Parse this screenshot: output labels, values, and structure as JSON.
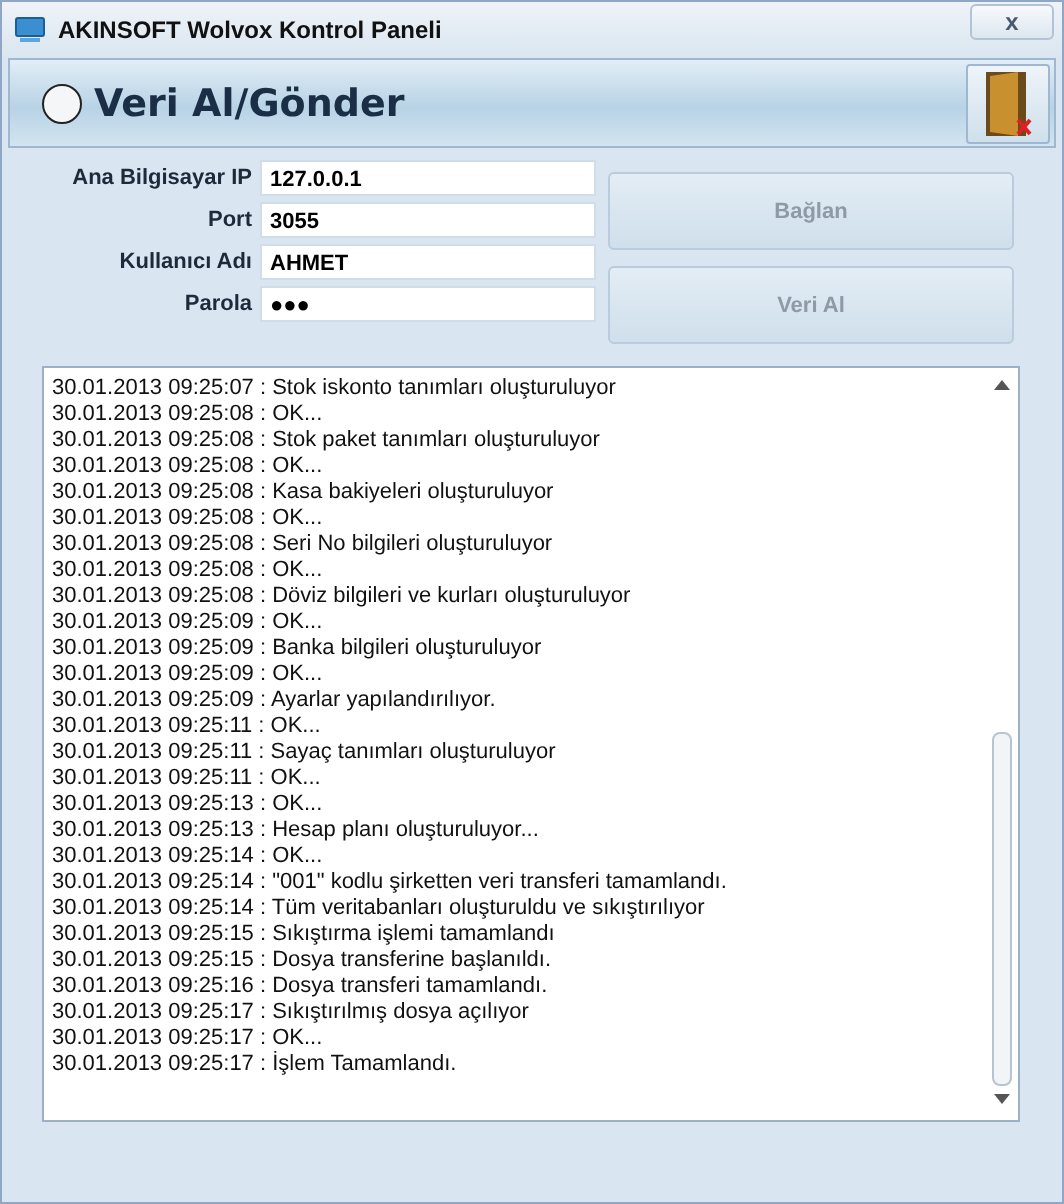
{
  "window": {
    "title": "AKINSOFT Wolvox Kontrol Paneli",
    "close_symbol": "x"
  },
  "header": {
    "title": "Veri Al/Gönder"
  },
  "form": {
    "fields": [
      {
        "label": "Ana Bilgisayar IP",
        "value": "127.0.0.1"
      },
      {
        "label": "Port",
        "value": "3055"
      },
      {
        "label": "Kullanıcı Adı",
        "value": "AHMET"
      },
      {
        "label": "Parola",
        "value": "●●●"
      }
    ],
    "buttons": [
      {
        "label": "Bağlan",
        "disabled": true
      },
      {
        "label": "Veri Al",
        "disabled": true
      }
    ]
  },
  "log": [
    "30.01.2013 09:25:07 : Stok iskonto tanımları oluşturuluyor",
    "30.01.2013 09:25:08 : OK...",
    "30.01.2013 09:25:08 : Stok paket tanımları oluşturuluyor",
    "30.01.2013 09:25:08 : OK...",
    "30.01.2013 09:25:08 : Kasa bakiyeleri oluşturuluyor",
    "30.01.2013 09:25:08 : OK...",
    "30.01.2013 09:25:08 : Seri No bilgileri oluşturuluyor",
    "30.01.2013 09:25:08 : OK...",
    "30.01.2013 09:25:08 : Döviz bilgileri ve kurları oluşturuluyor",
    "30.01.2013 09:25:09 : OK...",
    "30.01.2013 09:25:09 : Banka bilgileri oluşturuluyor",
    "30.01.2013 09:25:09 : OK...",
    "30.01.2013 09:25:09 : Ayarlar yapılandırılıyor.",
    "30.01.2013 09:25:11 : OK...",
    "30.01.2013 09:25:11 : Sayaç tanımları oluşturuluyor",
    "30.01.2013 09:25:11 : OK...",
    "30.01.2013 09:25:13 : OK...",
    "30.01.2013 09:25:13 : Hesap planı oluşturuluyor...",
    "30.01.2013 09:25:14 : OK...",
    "30.01.2013 09:25:14 : \"001\" kodlu şirketten veri transferi tamamlandı.",
    "30.01.2013 09:25:14 : Tüm veritabanları oluşturuldu ve sıkıştırılıyor",
    "30.01.2013 09:25:15 : Sıkıştırma işlemi tamamlandı",
    "30.01.2013 09:25:15 : Dosya transferine başlanıldı.",
    "30.01.2013 09:25:16 : Dosya transferi tamamlandı.",
    "30.01.2013 09:25:17 : Sıkıştırılmış dosya açılıyor",
    "30.01.2013 09:25:17 : OK...",
    "30.01.2013 09:25:17 : İşlem Tamamlandı."
  ]
}
